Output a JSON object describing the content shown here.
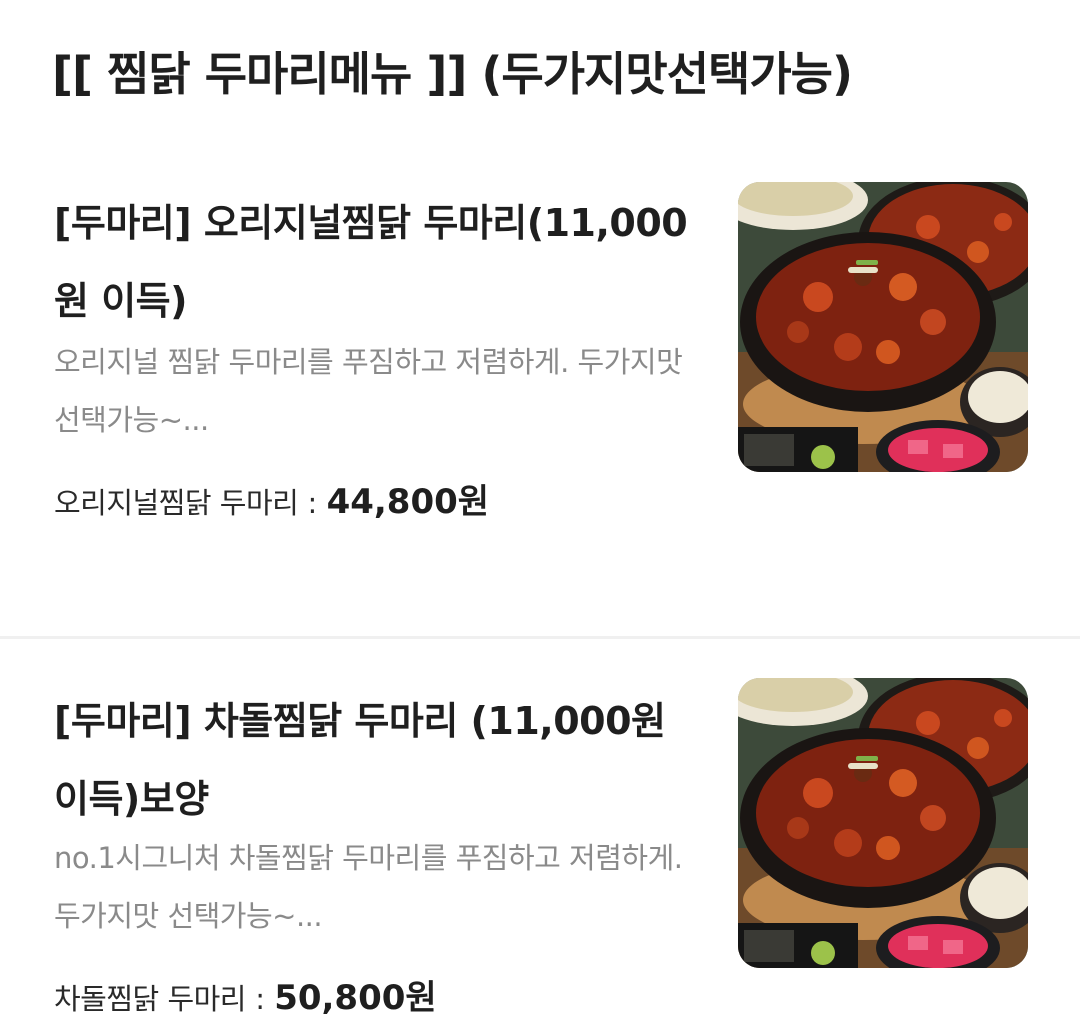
{
  "section": {
    "title": "[[ 찜닭 두마리메뉴 ]] (두가지맛선택가능)"
  },
  "items": [
    {
      "name": "[두마리] 오리지널찜닭 두마리(11,000원 이득)",
      "description": "오리지널 찜닭 두마리를 푸짐하고 저렴하게. 두가지맛 선택가능~...",
      "price_label": "오리지널찜닭 두마리",
      "price_separator": " : ",
      "price": "44,800원",
      "image_icon": "braised-chicken-photo"
    },
    {
      "name": "[두마리] 차돌찜닭 두마리 (11,000원이득)보양",
      "description": "no.1시그니처 차돌찜닭 두마리를 푸짐하고 저렴하게.두가지맛 선택가능~...",
      "price_label": "차돌찜닭 두마리",
      "price_separator": " : ",
      "price": "50,800원",
      "image_icon": "braised-chicken-photo"
    }
  ]
}
